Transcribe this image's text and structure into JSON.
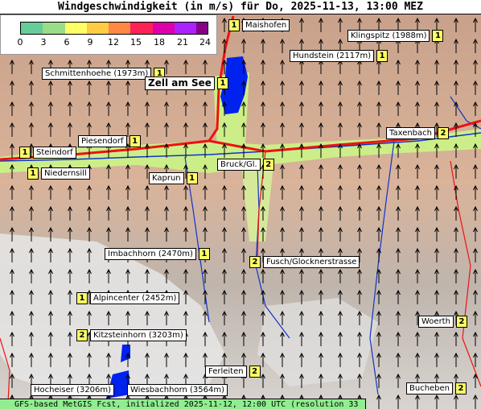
{
  "title": "Windgeschwindigkeit (in m/s) für Do, 2025-11-13, 13:00 MEZ",
  "legend": {
    "ticks": [
      "0",
      "3",
      "6",
      "9",
      "12",
      "15",
      "18",
      "21",
      "24"
    ],
    "colors": [
      "#66cc99",
      "#99dd88",
      "#ffff66",
      "#ffcc44",
      "#ff8844",
      "#ff2255",
      "#dd00aa",
      "#aa22ff",
      "#880088"
    ]
  },
  "labels": [
    {
      "num": "1",
      "name": "Maishofen",
      "side": "right"
    },
    {
      "num": "1",
      "name": "Klingspitz (1988m)",
      "side": "left"
    },
    {
      "num": "1",
      "name": "Hundstein (2117m)",
      "side": "left"
    },
    {
      "num": "1",
      "name": "Schmittenhoehe (1973m)",
      "side": "left"
    },
    {
      "num": "1",
      "name": "Zell am See",
      "side": "left",
      "big": true
    },
    {
      "num": "2",
      "name": "Taxenbach",
      "side": "left"
    },
    {
      "num": "1",
      "name": "Piesendorf",
      "side": "left"
    },
    {
      "num": "1",
      "name": "Steindorf",
      "side": "right"
    },
    {
      "num": "2",
      "name": "Bruck/Gl.",
      "side": "left"
    },
    {
      "num": "1",
      "name": "Niedernsill",
      "side": "right"
    },
    {
      "num": "1",
      "name": "Kaprun",
      "side": "left"
    },
    {
      "num": "1",
      "name": "Imbachhorn (2470m)",
      "side": "left"
    },
    {
      "num": "2",
      "name": "Fusch/Glocknerstrasse",
      "side": "right"
    },
    {
      "num": "1",
      "name": "Alpincenter (2452m)",
      "side": "right"
    },
    {
      "num": "2",
      "name": "Woerth",
      "side": "left"
    },
    {
      "num": "2",
      "name": "Kitzsteinhorn (3203m)",
      "side": "right"
    },
    {
      "num": "2",
      "name": "Ferleiten",
      "side": "left"
    },
    {
      "num": "2",
      "name": "Bucheben",
      "side": "left"
    },
    {
      "num": "",
      "name": "Hocheiser (3206m)",
      "side": "left"
    },
    {
      "num": "",
      "name": "Wiesbachhorn (3564m)",
      "side": "left"
    }
  ],
  "footer": "GFS-based MetGIS Fcst, initialized 2025-11-12, 12:00 UTC  (resolution 33 m X 48 m)"
}
